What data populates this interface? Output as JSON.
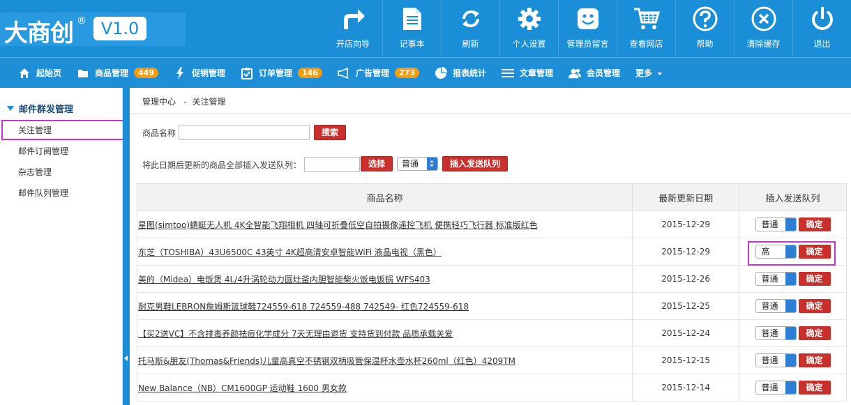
{
  "app": {
    "logo_text": "大商创",
    "logo_reg": "®",
    "version": "V1.0"
  },
  "top_nav": [
    {
      "label": "开店向导",
      "icon": "share-arrow-icon"
    },
    {
      "label": "记事本",
      "icon": "notepad-icon"
    },
    {
      "label": "刷新",
      "icon": "refresh-icon"
    },
    {
      "label": "个人设置",
      "icon": "gear-icon"
    },
    {
      "label": "管理员留言",
      "icon": "smiley-message-icon"
    },
    {
      "label": "查看网店",
      "icon": "shopping-cart-icon"
    },
    {
      "label": "帮助",
      "icon": "help-icon"
    },
    {
      "label": "清除缓存",
      "icon": "clear-icon"
    },
    {
      "label": "退出",
      "icon": "power-icon"
    }
  ],
  "sub_nav": [
    {
      "label": "起始页",
      "icon": "home-icon",
      "badge": ""
    },
    {
      "label": "商品管理",
      "icon": "folder-icon",
      "badge": "449"
    },
    {
      "label": "促销管理",
      "icon": "lightning-icon",
      "badge": ""
    },
    {
      "label": "订单管理",
      "icon": "clipboard-icon",
      "badge": "146"
    },
    {
      "label": "广告管理",
      "icon": "megaphone-icon",
      "badge": "273"
    },
    {
      "label": "报表统计",
      "icon": "pie-chart-icon",
      "badge": ""
    },
    {
      "label": "文章管理",
      "icon": "list-icon",
      "badge": ""
    },
    {
      "label": "会员管理",
      "icon": "users-icon",
      "badge": ""
    }
  ],
  "sub_nav_more": "更多",
  "sidebar": {
    "title": "邮件群发管理",
    "items": [
      {
        "label": "关注管理"
      },
      {
        "label": "邮件订阅管理"
      },
      {
        "label": "杂志管理"
      },
      {
        "label": "邮件队列管理"
      }
    ]
  },
  "breadcrumb": {
    "root": "管理中心",
    "sep": "-",
    "current": "关注管理"
  },
  "search": {
    "label": "商品名称",
    "value": "",
    "button": "搜索"
  },
  "insert_form": {
    "label": "将此日期后更新的商品全部插入发送队列：",
    "date_value": "",
    "choose_button": "选择",
    "priority": "普通",
    "insert_button": "插入发送队列"
  },
  "table": {
    "headers": [
      "商品名称",
      "最新更新日期",
      "插入发送队列"
    ],
    "confirm_label": "确定",
    "rows": [
      {
        "name": "星图(simtoo)蜻蜓无人机 4K全智能飞翔相机 四轴可折叠低空自拍摄像遥控飞机 便携轻巧飞行器 标准版红色",
        "date": "2015-12-29",
        "priority": "普通"
      },
      {
        "name": "东芝（TOSHIBA）43U6500C 43英寸 4K超高清安卓智能WiFi 液晶电视（黑色）",
        "date": "2015-12-29",
        "priority": "高"
      },
      {
        "name": "美的（Midea）电饭煲 4L/4升涡轮动力圆灶釜内胆智能柴火饭电饭锅 WFS403",
        "date": "2015-12-26",
        "priority": "普通"
      },
      {
        "name": "耐克男鞋LEBRON詹姆斯篮球鞋724559-618 724559-488 742549- 红色724559-618",
        "date": "2015-12-25",
        "priority": "普通"
      },
      {
        "name": "【买2送VC】不含排毒养颜祛痘化学成分 7天无理由退货 支持货到付款 品质承载关爱",
        "date": "2015-12-24",
        "priority": "普通"
      },
      {
        "name": "托马斯&朋友(Thomas&Friends)儿童高真空不锈钢双柄吸管保温杯水壶水杯260ml（红色）4209TM",
        "date": "2015-12-15",
        "priority": "普通"
      },
      {
        "name": "New Balance（NB）CM1600GP 运动鞋 1600 男女款",
        "date": "2015-12-14",
        "priority": "普通"
      }
    ]
  },
  "colors": {
    "header_bg": "#1a8fd8",
    "badge": "#f39c12",
    "button_red": "#c9302c",
    "highlight": "#cc33cc"
  }
}
